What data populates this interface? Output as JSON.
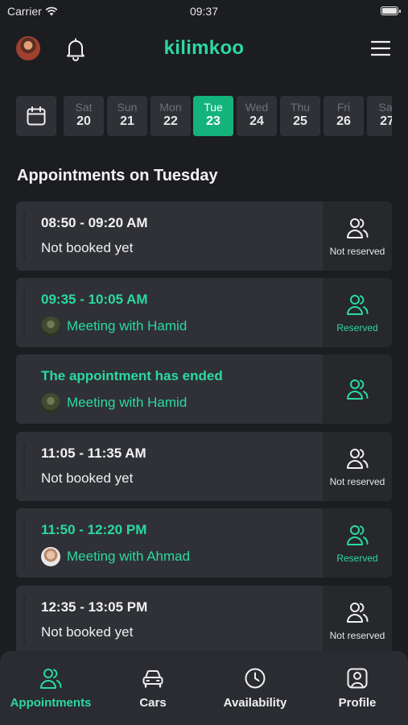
{
  "status_bar": {
    "carrier": "Carrier",
    "time": "09:37"
  },
  "header": {
    "brand": "kilimkoo"
  },
  "dates": [
    {
      "day": "Sat",
      "date": "20",
      "selected": false
    },
    {
      "day": "Sun",
      "date": "21",
      "selected": false
    },
    {
      "day": "Mon",
      "date": "22",
      "selected": false
    },
    {
      "day": "Tue",
      "date": "23",
      "selected": true
    },
    {
      "day": "Wed",
      "date": "24",
      "selected": false
    },
    {
      "day": "Thu",
      "date": "25",
      "selected": false
    },
    {
      "day": "Fri",
      "date": "26",
      "selected": false
    },
    {
      "day": "Sat",
      "date": "27",
      "selected": false
    }
  ],
  "section_title": "Appointments on Tuesday",
  "appointments": [
    {
      "title": "08:50 - 09:20 AM",
      "subtitle": "Not booked yet",
      "status": "Not reserved"
    },
    {
      "title": "09:35 - 10:05 AM",
      "subtitle": "Meeting with Hamid",
      "status": "Reserved"
    },
    {
      "title": "The appointment has ended",
      "subtitle": "Meeting with Hamid",
      "status": ""
    },
    {
      "title": "11:05 - 11:35 AM",
      "subtitle": "Not booked yet",
      "status": "Not reserved"
    },
    {
      "title": "11:50 - 12:20 PM",
      "subtitle": "Meeting with Ahmad",
      "status": "Reserved"
    },
    {
      "title": "12:35 - 13:05 PM",
      "subtitle": "Not booked yet",
      "status": "Not reserved"
    }
  ],
  "tabs": [
    {
      "label": "Appointments",
      "icon": "users-icon",
      "active": true
    },
    {
      "label": "Cars",
      "icon": "car-icon",
      "active": false
    },
    {
      "label": "Availability",
      "icon": "clock-icon",
      "active": false
    },
    {
      "label": "Profile",
      "icon": "profile-icon",
      "active": false
    }
  ],
  "colors": {
    "accent": "#2bd9a1",
    "selected_day": "#14b37d",
    "background": "#1c1d21",
    "card": "#2f3136"
  }
}
